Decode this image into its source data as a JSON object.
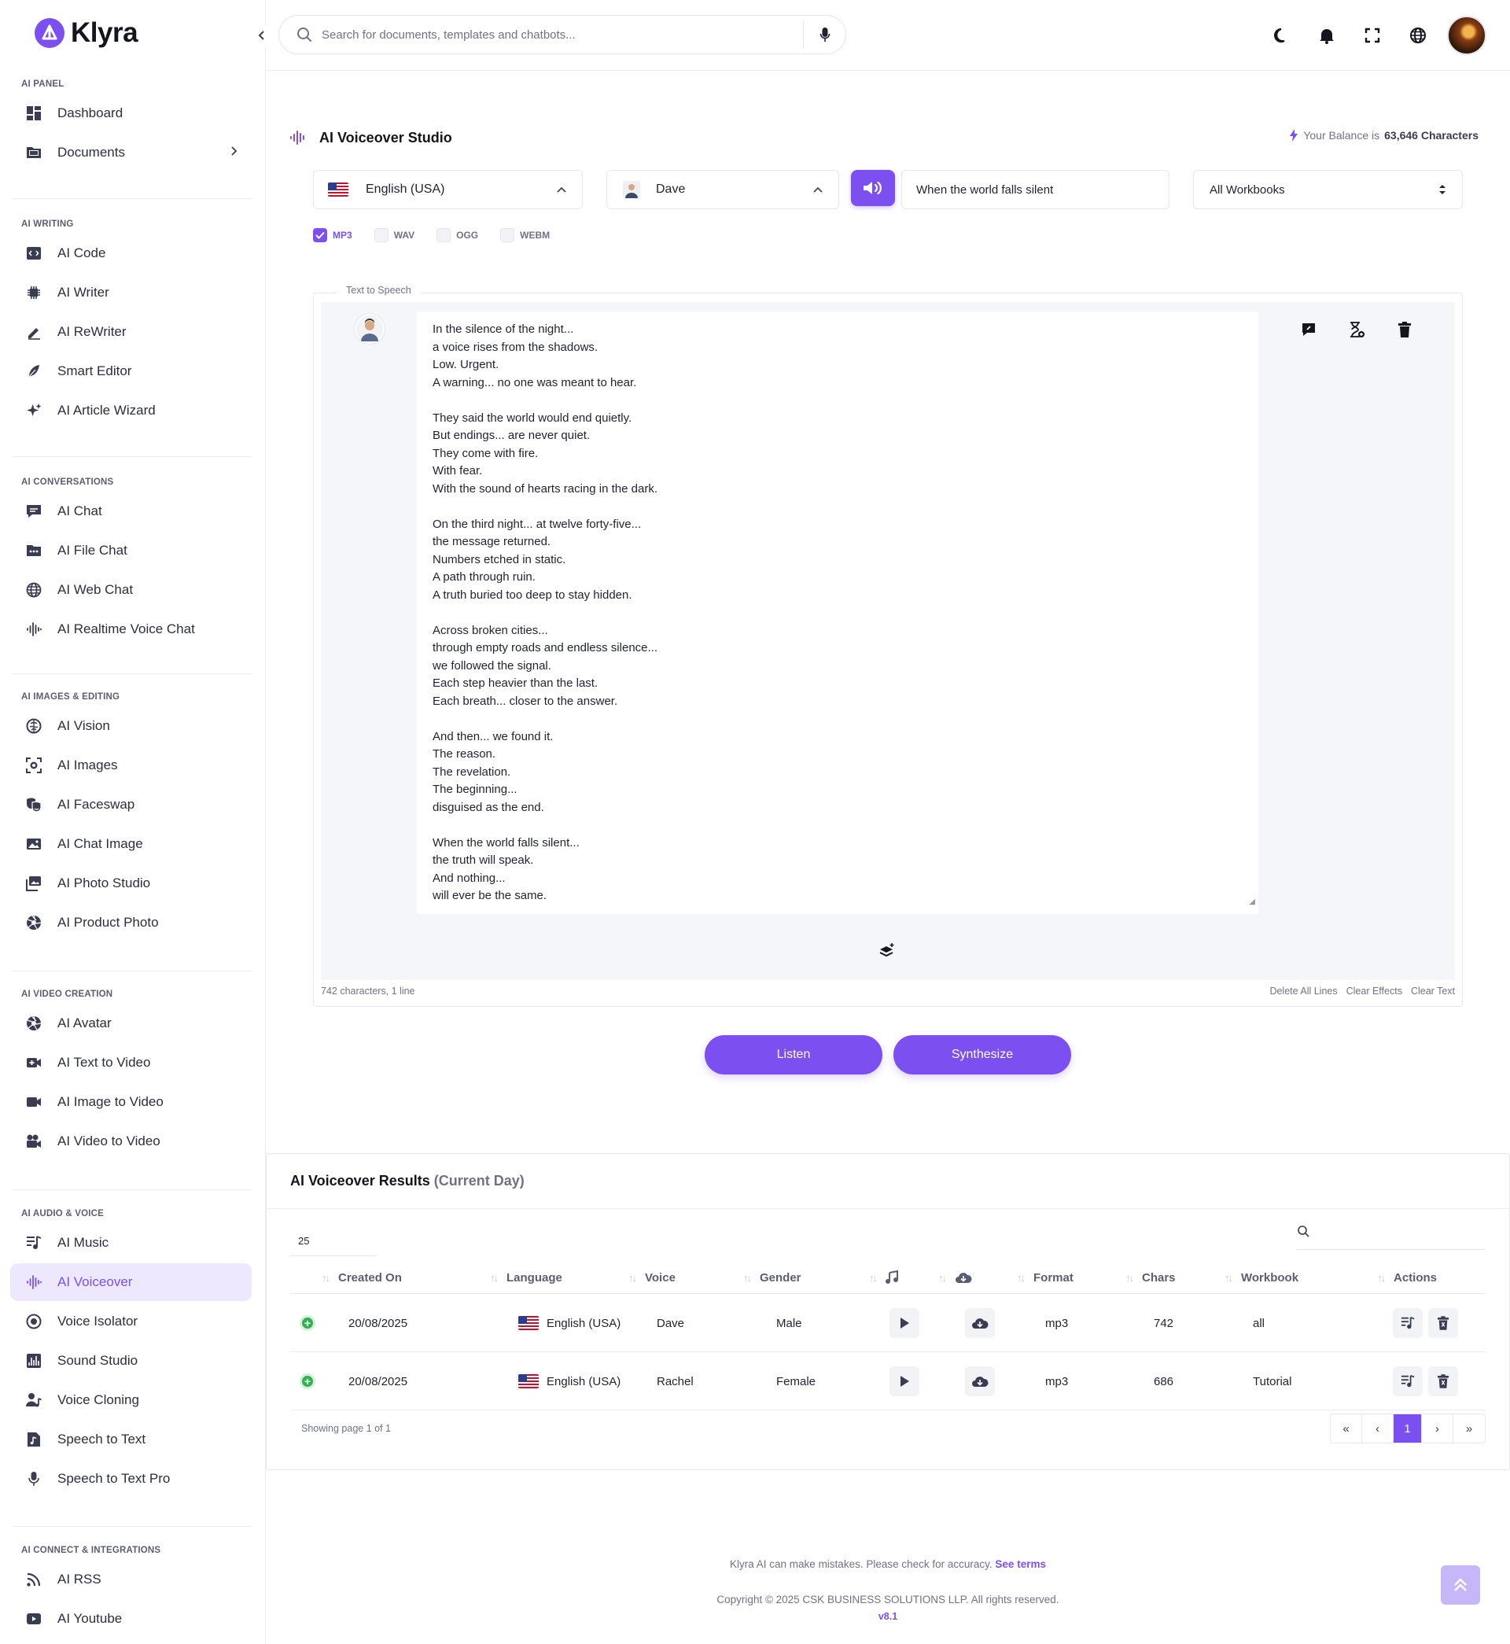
{
  "brand": {
    "name": "Klyra"
  },
  "search": {
    "placeholder": "Search for documents, templates and chatbots..."
  },
  "sidebar": {
    "sections": [
      {
        "title": "AI PANEL",
        "items": [
          {
            "label": "Dashboard",
            "icon": "dashboard-icon"
          },
          {
            "label": "Documents",
            "icon": "folder-icon",
            "has_chevron": true
          }
        ]
      },
      {
        "title": "AI WRITING",
        "items": [
          {
            "label": "AI Code",
            "icon": "code-icon"
          },
          {
            "label": "AI Writer",
            "icon": "chip-icon"
          },
          {
            "label": "AI ReWriter",
            "icon": "pen-icon"
          },
          {
            "label": "Smart Editor",
            "icon": "feather-icon"
          },
          {
            "label": "AI Article Wizard",
            "icon": "sparkles-icon"
          }
        ]
      },
      {
        "title": "AI CONVERSATIONS",
        "items": [
          {
            "label": "AI Chat",
            "icon": "chat-icon"
          },
          {
            "label": "AI File Chat",
            "icon": "folder-dots-icon"
          },
          {
            "label": "AI Web Chat",
            "icon": "globe-icon"
          },
          {
            "label": "AI Realtime Voice Chat",
            "icon": "waveform-icon"
          }
        ]
      },
      {
        "title": "AI IMAGES & EDITING",
        "items": [
          {
            "label": "AI Vision",
            "icon": "brain-icon"
          },
          {
            "label": "AI Images",
            "icon": "camera-focus-icon"
          },
          {
            "label": "AI Faceswap",
            "icon": "masks-icon"
          },
          {
            "label": "AI Chat Image",
            "icon": "image-icon"
          },
          {
            "label": "AI Photo Studio",
            "icon": "photos-icon"
          },
          {
            "label": "AI Product Photo",
            "icon": "aperture-icon"
          }
        ]
      },
      {
        "title": "AI VIDEO CREATION",
        "items": [
          {
            "label": "AI Avatar",
            "icon": "aperture-icon"
          },
          {
            "label": "AI Text to Video",
            "icon": "video-plus-icon"
          },
          {
            "label": "AI Image to Video",
            "icon": "video-icon"
          },
          {
            "label": "AI Video to Video",
            "icon": "film-camera-icon"
          }
        ]
      },
      {
        "title": "AI AUDIO & VOICE",
        "items": [
          {
            "label": "AI Music",
            "icon": "music-list-icon"
          },
          {
            "label": "AI Voiceover",
            "icon": "waveform-icon",
            "active": true
          },
          {
            "label": "Voice Isolator",
            "icon": "target-icon"
          },
          {
            "label": "Sound Studio",
            "icon": "sound-studio-icon"
          },
          {
            "label": "Voice Cloning",
            "icon": "user-music-icon"
          },
          {
            "label": "Speech to Text",
            "icon": "music-file-icon"
          },
          {
            "label": "Speech to Text Pro",
            "icon": "microphone-icon"
          }
        ]
      },
      {
        "title": "AI CONNECT & INTEGRATIONS",
        "items": [
          {
            "label": "AI RSS",
            "icon": "rss-icon"
          },
          {
            "label": "AI Youtube",
            "icon": "youtube-icon"
          }
        ]
      }
    ]
  },
  "studio": {
    "title": "AI Voiceover Studio",
    "balance_prefix": "Your Balance is",
    "balance_value": "63,646 Characters",
    "language": "English (USA)",
    "voice": "Dave",
    "title_input": "When the world falls silent",
    "workbook": "All Workbooks",
    "formats": [
      {
        "label": "MP3",
        "checked": true
      },
      {
        "label": "WAV",
        "checked": false
      },
      {
        "label": "OGG",
        "checked": false
      },
      {
        "label": "WEBM",
        "checked": false
      }
    ],
    "tts_legend": "Text to Speech",
    "text": "In the silence of the night...\na voice rises from the shadows.\nLow. Urgent.\nA warning... no one was meant to hear.\n\nThey said the world would end quietly.\nBut endings... are never quiet.\nThey come with fire.\nWith fear.\nWith the sound of hearts racing in the dark.\n\nOn the third night... at twelve forty-five...\nthe message returned.\nNumbers etched in static.\nA path through ruin.\nA truth buried too deep to stay hidden.\n\nAcross broken cities...\nthrough empty roads and endless silence...\nwe followed the signal.\nEach step heavier than the last.\nEach breath... closer to the answer.\n\nAnd then... we found it.\nThe reason.\nThe revelation.\nThe beginning...\ndisguised as the end.\n\nWhen the world falls silent...\nthe truth will speak.\nAnd nothing...\nwill ever be the same.",
    "char_count": "742 characters, 1 line",
    "footer_links": [
      "Delete All Lines",
      "Clear Effects",
      "Clear Text"
    ],
    "listen_label": "Listen",
    "synthesize_label": "Synthesize"
  },
  "results": {
    "title": "AI Voiceover Results",
    "subtitle": "(Current Day)",
    "page_size": "25",
    "columns": [
      "Created On",
      "Language",
      "Voice",
      "Gender",
      "Format",
      "Chars",
      "Workbook",
      "Actions"
    ],
    "rows": [
      {
        "created": "20/08/2025",
        "language": "English (USA)",
        "voice": "Dave",
        "gender": "Male",
        "format": "mp3",
        "chars": "742",
        "workbook": "all"
      },
      {
        "created": "20/08/2025",
        "language": "English (USA)",
        "voice": "Rachel",
        "gender": "Female",
        "format": "mp3",
        "chars": "686",
        "workbook": "Tutorial"
      }
    ],
    "showing": "Showing page 1 of 1",
    "pager": [
      "«",
      "‹",
      "1",
      "›",
      "»"
    ]
  },
  "footer": {
    "disclaimer": "Klyra AI can make mistakes. Please check for accuracy.",
    "terms_link": "See terms",
    "copyright": "Copyright © 2025 CSK BUSINESS SOLUTIONS LLP. All rights reserved.",
    "version": "v8.1"
  },
  "colors": {
    "accent": "#7b4ff0",
    "accent_light": "#ede8fd",
    "success": "#2fb24f"
  }
}
